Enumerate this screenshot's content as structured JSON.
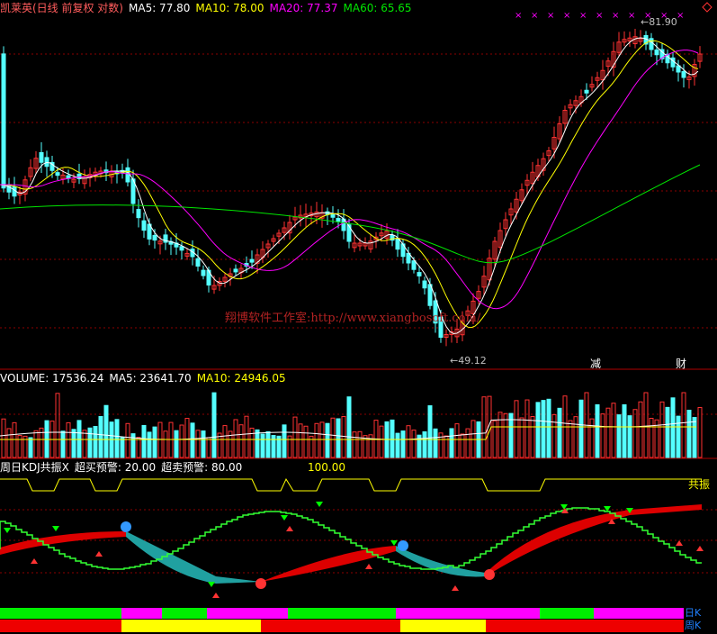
{
  "header": {
    "stock": "凯莱英(日线 前复权 对数)",
    "ma5": "MA5: 77.80",
    "ma10": "MA10: 78.00",
    "ma20": "MA20: 77.37",
    "ma60": "MA60: 65.65"
  },
  "annotations": {
    "high": "81.90",
    "low": "49.12",
    "watermark": "翔博软件工作室:http://www.xiangbosoft.com/",
    "tag_jian": "减",
    "tag_cai": "财"
  },
  "volume_header": {
    "volume": "VOLUME: 17536.24",
    "ma5": "MA5: 23641.70",
    "ma10": "MA10: 24946.05"
  },
  "kdj_header": {
    "title": "周日KDJ共振X",
    "overbuy": "超买预警: 20.00",
    "oversell": "超卖预警: 80.00",
    "level": "100.00",
    "resonance": "共振"
  },
  "footer_tabs": {
    "day": "日K",
    "week": "周K"
  },
  "colors": {
    "up": "#ff3232",
    "down": "#54ffff",
    "ma5": "#ffffff",
    "ma10": "#ffff00",
    "ma20": "#ff00ff",
    "ma60": "#00e600",
    "grid": "#8b0000"
  },
  "chart_data": [
    {
      "type": "candlestick",
      "title": "凯莱英(日线 前复权 对数)",
      "series": [
        {
          "name": "MA5",
          "values": [
            77.8
          ]
        },
        {
          "name": "MA10",
          "values": [
            78.0
          ]
        },
        {
          "name": "MA20",
          "values": [
            77.37
          ]
        },
        {
          "name": "MA60",
          "values": [
            65.65
          ]
        }
      ],
      "annotations": [
        {
          "label": "81.90",
          "kind": "high"
        },
        {
          "label": "49.12",
          "kind": "low"
        }
      ]
    },
    {
      "type": "bar",
      "title": "VOLUME",
      "series": [
        {
          "name": "VOLUME",
          "values": [
            17536.24
          ]
        },
        {
          "name": "MA5",
          "values": [
            23641.7
          ]
        },
        {
          "name": "MA10",
          "values": [
            24946.05
          ]
        }
      ]
    },
    {
      "type": "area",
      "title": "周日KDJ共振X",
      "annotations": [
        {
          "label": "超买预警",
          "value": 20.0
        },
        {
          "label": "超卖预警",
          "value": 80.0
        },
        {
          "label": "",
          "value": 100.0
        }
      ]
    }
  ]
}
